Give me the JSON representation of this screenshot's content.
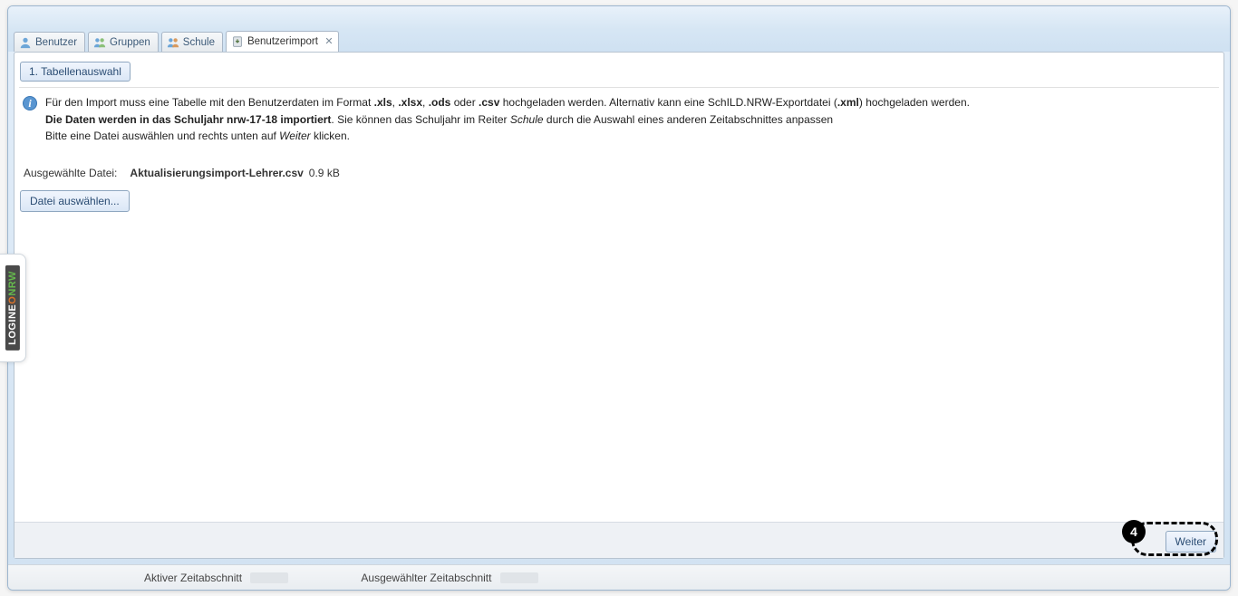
{
  "tabs": {
    "benutzer": {
      "label": "Benutzer"
    },
    "gruppen": {
      "label": "Gruppen"
    },
    "schule": {
      "label": "Schule"
    },
    "import": {
      "label": "Benutzerimport"
    }
  },
  "step": {
    "label": "1. Tabellenauswahl"
  },
  "info": {
    "line1_pre": "Für den Import muss eine Tabelle mit den Benutzerdaten im Format ",
    "fmt_xls": ".xls",
    "sep1": ", ",
    "fmt_xlsx": ".xlsx",
    "sep2": ", ",
    "fmt_ods": ".ods",
    "sep3": " oder ",
    "fmt_csv": ".csv",
    "line1_mid": " hochgeladen werden. Alternativ kann eine SchILD.NRW-Exportdatei (",
    "fmt_xml": ".xml",
    "line1_post": ") hochgeladen werden.",
    "line2_bold": "Die Daten werden in das Schuljahr nrw-17-18 importiert",
    "line2_post_a": ". Sie können das Schuljahr im Reiter ",
    "line2_italic": "Schule",
    "line2_post_b": " durch die Auswahl eines anderen Zeitabschnittes anpassen",
    "line3_pre": "Bitte eine Datei auswählen und rechts unten auf ",
    "line3_italic": "Weiter",
    "line3_post": " klicken."
  },
  "selected_file": {
    "label": "Ausgewählte Datei:",
    "name": "Aktualisierungsimport-Lehrer.csv",
    "size": "0.9 kB"
  },
  "buttons": {
    "choose_file": "Datei auswählen...",
    "next": "Weiter"
  },
  "annotation": {
    "number": "4"
  },
  "status": {
    "active": "Aktiver Zeitabschnitt",
    "selected": "Ausgewählter Zeitabschnitt"
  },
  "side": {
    "logineo": "LOGINE",
    "o": "O",
    "nrw": "NRW"
  }
}
